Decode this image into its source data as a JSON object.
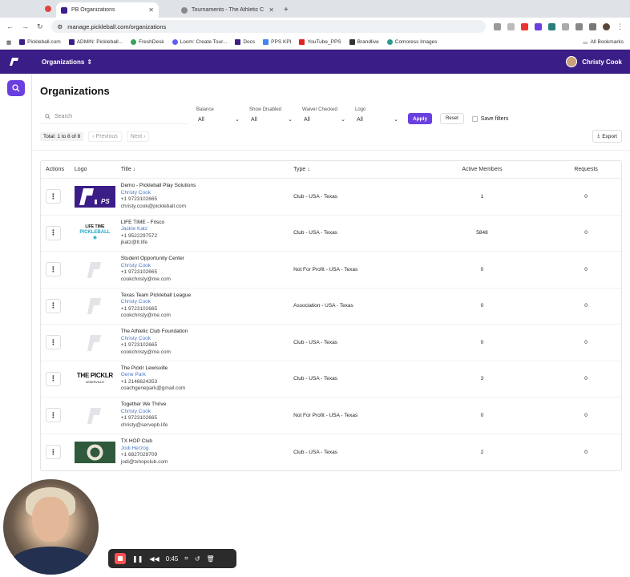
{
  "browser": {
    "tabs": [
      {
        "title": "PB Organizations",
        "active": true
      },
      {
        "title": "Tournaments - The Athletic C",
        "active": false
      }
    ],
    "url": "manage.pickleball.com/organizations",
    "bookmarks": [
      "Pickleball.com",
      "ADMIN: Pickleball...",
      "FreshDesk",
      "Loom: Create Tour...",
      "Docs",
      "PPS KPI",
      "YouTube_PPS",
      "Brandlive",
      "Comoress Images"
    ],
    "all_bookmarks": "All Bookmarks"
  },
  "appbar": {
    "org_switch": "Organizations",
    "user_name": "Christy Cook"
  },
  "page": {
    "title": "Organizations",
    "search_placeholder": "Search",
    "filters": [
      {
        "label": "Balance",
        "value": "All"
      },
      {
        "label": "Show Disabled",
        "value": "All"
      },
      {
        "label": "Waiver Checked",
        "value": "All"
      },
      {
        "label": "Logo",
        "value": "All"
      }
    ],
    "apply": "Apply",
    "reset": "Reset",
    "save_filters": "Save filters",
    "total": "Total: 1 to 8 of 8",
    "previous": "‹ Previous",
    "next": "Next ›",
    "export": "Export"
  },
  "table": {
    "headers": {
      "actions": "Actions",
      "logo": "Logo",
      "title": "Title ↓",
      "type": "Type ↓",
      "members": "Active Members",
      "requests": "Requests"
    },
    "rows": [
      {
        "name": "Demo - Pickleball Play Solutions",
        "contact": "Christy Cook",
        "phone": "+1 9723102665",
        "email": "christy.cook@pickleball.com",
        "type": "Club - USA - Texas",
        "members": "1",
        "requests": "0",
        "logo": "pps"
      },
      {
        "name": "LIFE TIME - Frisco",
        "contact": "Jackie Katz",
        "phone": "+1 9522297572",
        "email": "jkatz@lt.life",
        "type": "Club - USA - Texas",
        "members": "5848",
        "requests": "0",
        "logo": "lifetime"
      },
      {
        "name": "Student Opportunity Center",
        "contact": "Christy Cook",
        "phone": "+1 9723102665",
        "email": "cookchristy@me.com",
        "type": "Not For Profit - USA - Texas",
        "members": "0",
        "requests": "0",
        "logo": "placeholder"
      },
      {
        "name": "Texas Team Pickleball League",
        "contact": "Christy Cook",
        "phone": "+1 9723102665",
        "email": "cookchristy@me.com",
        "type": "Association - USA - Texas",
        "members": "0",
        "requests": "0",
        "logo": "placeholder"
      },
      {
        "name": "The Athletic Club Foundation",
        "contact": "Christy Cook",
        "phone": "+1 9723102665",
        "email": "cookchristy@me.com",
        "type": "Club - USA - Texas",
        "members": "0",
        "requests": "0",
        "logo": "placeholder"
      },
      {
        "name": "The Picklr Lewisville",
        "contact": "Gene Park",
        "phone": "+1 2146624353",
        "email": "coachgenepark@gmail.com",
        "type": "Club - USA - Texas",
        "members": "3",
        "requests": "0",
        "logo": "picklr"
      },
      {
        "name": "Together We Thrive",
        "contact": "Christy Cook",
        "phone": "+1 9723102665",
        "email": "christy@servepb.life",
        "type": "Not For Profit - USA - Texas",
        "members": "0",
        "requests": "0",
        "logo": "placeholder"
      },
      {
        "name": "TX HOP Club",
        "contact": "Jodi Herzog",
        "phone": "+1 6827029709",
        "email": "jodi@txhopclub.com",
        "type": "Club - USA - Texas",
        "members": "2",
        "requests": "0",
        "logo": "txhop"
      }
    ]
  },
  "logos": {
    "lifetime_line1": "LIFE TIME",
    "lifetime_line2": "PICKLEBALL",
    "picklr_line1": "THE PICKLR",
    "picklr_line2": "LEWISVILLE"
  },
  "recorder": {
    "time": "0:45"
  },
  "colors": {
    "brand": "#3b1d87",
    "accent": "#6a3fe0",
    "link": "#4a78c8"
  }
}
